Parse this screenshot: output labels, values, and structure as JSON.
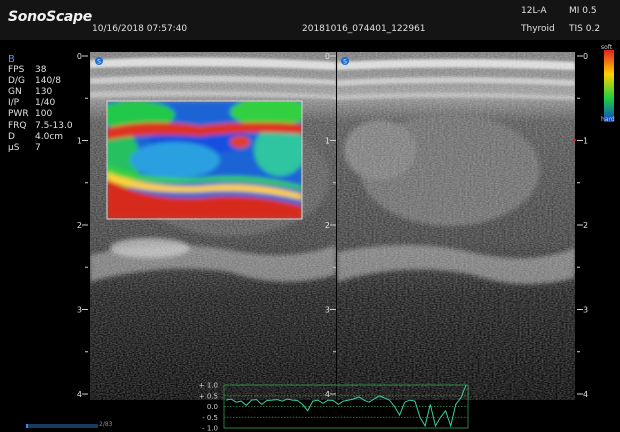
{
  "header": {
    "brand": "SonoScape",
    "datetime": "10/16/2018 07:57:40",
    "study_id": "20181016_074401_122961",
    "probe": "12L-A",
    "mi": "MI 0.5",
    "preset": "Thyroid",
    "tis": "TIS 0.2"
  },
  "params": {
    "mode": "B",
    "rows": [
      {
        "key": "FPS",
        "value": "38"
      },
      {
        "key": "D/G",
        "value": "140/8"
      },
      {
        "key": "GN",
        "value": "130"
      },
      {
        "key": "I/P",
        "value": "1/40"
      },
      {
        "key": "PWR",
        "value": "100"
      },
      {
        "key": "FRQ",
        "value": "7.5-13.0"
      },
      {
        "key": "D",
        "value": "4.0cm"
      },
      {
        "key": "µS",
        "value": "7"
      }
    ]
  },
  "depth_scale": {
    "ticks": [
      "0",
      "1",
      "2",
      "3",
      "4"
    ],
    "max_cm": 4
  },
  "colorbar": {
    "top_label": "soft",
    "bottom_label": "hard",
    "colors": [
      "#e02020",
      "#ffd000",
      "#20d040",
      "#1040d0"
    ]
  },
  "panes": [
    {
      "marker_icon": "orientation-marker-icon",
      "has_elastography_roi": true
    },
    {
      "marker_icon": "orientation-marker-icon",
      "has_elastography_roi": false
    }
  ],
  "strain_graph": {
    "y_labels": [
      "+ 1.0",
      "+ 0.5",
      "0.0",
      "- 0.5",
      "- 1.0"
    ],
    "line_color": "#3ccf9a",
    "frame_color": "#2f9a4a"
  },
  "cine": {
    "counter": "2/83",
    "progress": 0.024,
    "accent": "#2f8ff0"
  }
}
